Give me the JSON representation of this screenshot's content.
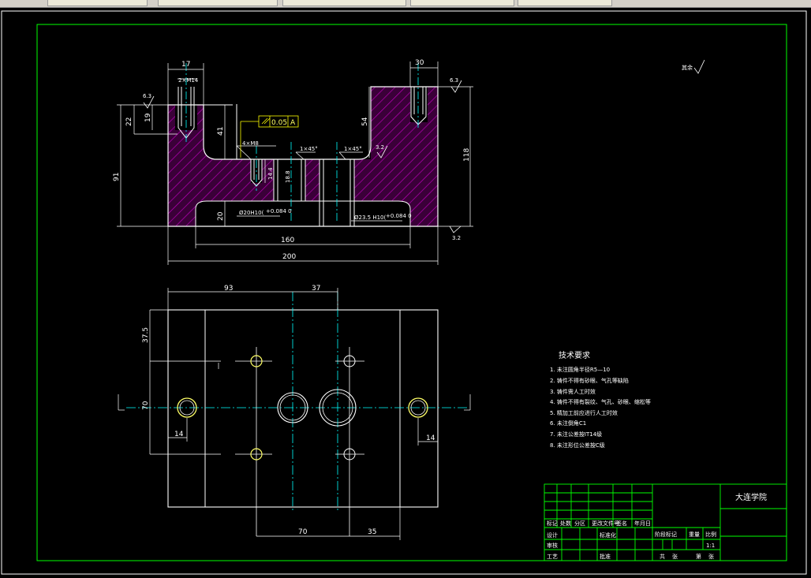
{
  "window": {
    "tabs": [
      "",
      "",
      "",
      "",
      "",
      ""
    ]
  },
  "front_view": {
    "dims": {
      "top_left_width": "17",
      "top_left_thread": "2×M14",
      "top_right_width": "30",
      "left_height_22": "22",
      "left_height_19": "19",
      "left_height_41": "41",
      "total_height": "91",
      "right_height_54": "54",
      "right_total": "118",
      "bottom_20": "20",
      "width_160": "160",
      "width_200": "200",
      "small_thread": "4×M8",
      "depth_14": "14.4",
      "depth_18": "18.8",
      "chamfer_1": "1×45°",
      "chamfer_2": "1×45°",
      "bore_1": "Ø20H10(",
      "bore_1_tol": "+0.084 0",
      "bore_2": "Ø23.5 H10(",
      "bore_2_tol": "+0.084 0",
      "parallel_tol": "0.05",
      "datum": "A",
      "rough_63_left": "6.3",
      "rough_63_right": "6.3",
      "rough_32_mid": "3.2",
      "rough_32_bottom": "3.2"
    }
  },
  "top_view": {
    "dims": {
      "width_93": "93",
      "width_37": "37",
      "height_375": "37.5",
      "height_70_left": "70",
      "offset_14_left": "14",
      "offset_14_right": "14",
      "width_70_bottom": "70",
      "width_35_bottom": "35"
    }
  },
  "roughness_note": "其余",
  "tech_requirements": {
    "title": "技术要求",
    "items": [
      "1. 未注圆角半径R5—10",
      "2. 铸件不得有砂眼、气孔等缺陷",
      "3. 铸件需人工时效",
      "4. 铸件不得有裂纹、气孔、砂眼、缩松等",
      "5. 精加工前应进行人工时效",
      "6. 未注倒角C1",
      "7. 未注公差按IT14级",
      "8. 未注形位公差按C级"
    ]
  },
  "title_block": {
    "school": "大连学院",
    "labels": {
      "mark": "标记",
      "count": "处数",
      "zone": "分区",
      "change_doc": "更改文件号",
      "sign": "签名",
      "date": "年月日",
      "design": "设计",
      "standard": "标准化",
      "review": "审核",
      "process": "工艺",
      "approve": "批准",
      "stage_mark": "阶段标记",
      "weight": "重量",
      "scale": "比例",
      "sheets": "共",
      "sheet": "张",
      "of": "第",
      "sheet2": "张",
      "ratio": "1:1"
    }
  },
  "colors": {
    "frame": "#00ff00",
    "part": "#ffffff",
    "hatch": "#ff00ff",
    "center": "#00ffff",
    "dim": "#ffffff",
    "tol": "#ffff00"
  }
}
